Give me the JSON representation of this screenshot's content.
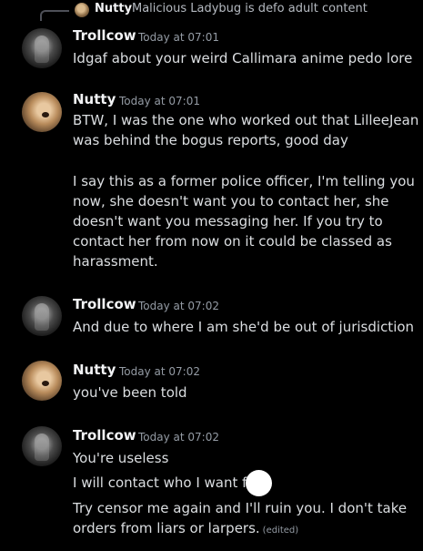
{
  "reply": {
    "author": "Nutty",
    "preview": "Malicious Ladybug is defo adult content"
  },
  "messages": [
    {
      "author": "Trollcow",
      "timestamp": "Today at 07:01",
      "lines": [
        "Idgaf about your weird Callimara anime pedo lore"
      ]
    },
    {
      "author": "Nutty",
      "timestamp": "Today at 07:01",
      "lines": [
        "BTW, I was the one who worked out that LilleeJean",
        "was behind the bogus reports, good day",
        "I say this as a former police officer, I'm telling you",
        "now, she doesn't want you to contact her, she",
        "doesn't want you messaging her. If you try to",
        "contact her from now on it could be classed as",
        "harassment."
      ]
    },
    {
      "author": "Trollcow",
      "timestamp": "Today at 07:02",
      "lines": [
        "And due to where I am she'd be out of jurisdiction"
      ]
    },
    {
      "author": "Nutty",
      "timestamp": "Today at 07:02",
      "lines": [
        "you've been told"
      ]
    },
    {
      "author": "Trollcow",
      "timestamp": "Today at 07:02",
      "lines": [
        "You're useless",
        "I will contact who I want fa t",
        "Try censor me again and I'll ruin you. I don't take",
        "orders from liars or larpers."
      ],
      "edited_label": "(edited)"
    }
  ]
}
